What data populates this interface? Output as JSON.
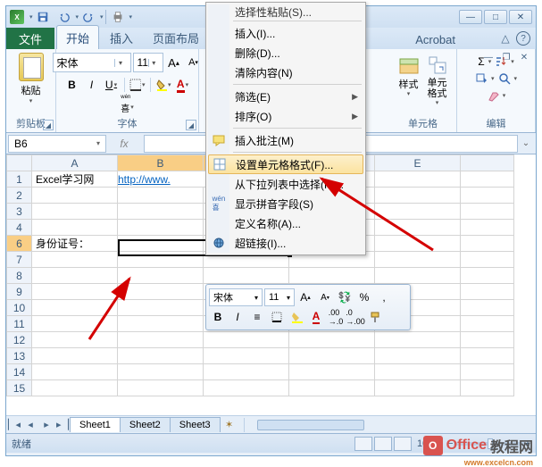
{
  "qat": {
    "excel_letter": "X"
  },
  "tabs": {
    "file": "文件",
    "home": "开始",
    "insert": "插入",
    "layout": "页面布局",
    "acrobat": "Acrobat"
  },
  "ribbon": {
    "clipboard": {
      "paste": "粘贴",
      "label": "剪贴板"
    },
    "font": {
      "name": "宋体",
      "size": "11",
      "label": "字体",
      "bold": "B",
      "italic": "I",
      "underline": "U"
    },
    "cells": {
      "styles": "样式",
      "format": "单元格式",
      "label": "单元格"
    },
    "editing": {
      "label": "编辑",
      "sigma": "Σ"
    }
  },
  "namebox": "B6",
  "fx": "fx",
  "columns": [
    "A",
    "B",
    "C",
    "D",
    "E"
  ],
  "rows_visible": 15,
  "cells": {
    "A1": "Excel学习网",
    "B1": "http://www.",
    "A6": "身份证号："
  },
  "selected_row": 6,
  "context_menu": {
    "paste_special_trunc": "选择性粘贴(S)...",
    "insert": "插入(I)...",
    "delete": "删除(D)...",
    "clear": "清除内容(N)",
    "filter": "筛选(E)",
    "sort": "排序(O)",
    "insert_comment": "插入批注(M)",
    "format_cells": "设置单元格格式(F)...",
    "dropdown": "从下拉列表中选择(K)...",
    "pinyin": "显示拼音字段(S)",
    "define_name": "定义名称(A)...",
    "hyperlink": "超链接(I)..."
  },
  "mini_toolbar": {
    "font": "宋体",
    "size": "11",
    "currency": "%",
    "comma": ","
  },
  "sheets": {
    "s1": "Sheet1",
    "s2": "Sheet2",
    "s3": "Sheet3"
  },
  "status": {
    "ready": "就绪",
    "zoom": "100%"
  },
  "watermark": {
    "icon": "O",
    "office": "Office",
    "suffix": "教程网",
    "sub": "www.excelcn.com"
  }
}
